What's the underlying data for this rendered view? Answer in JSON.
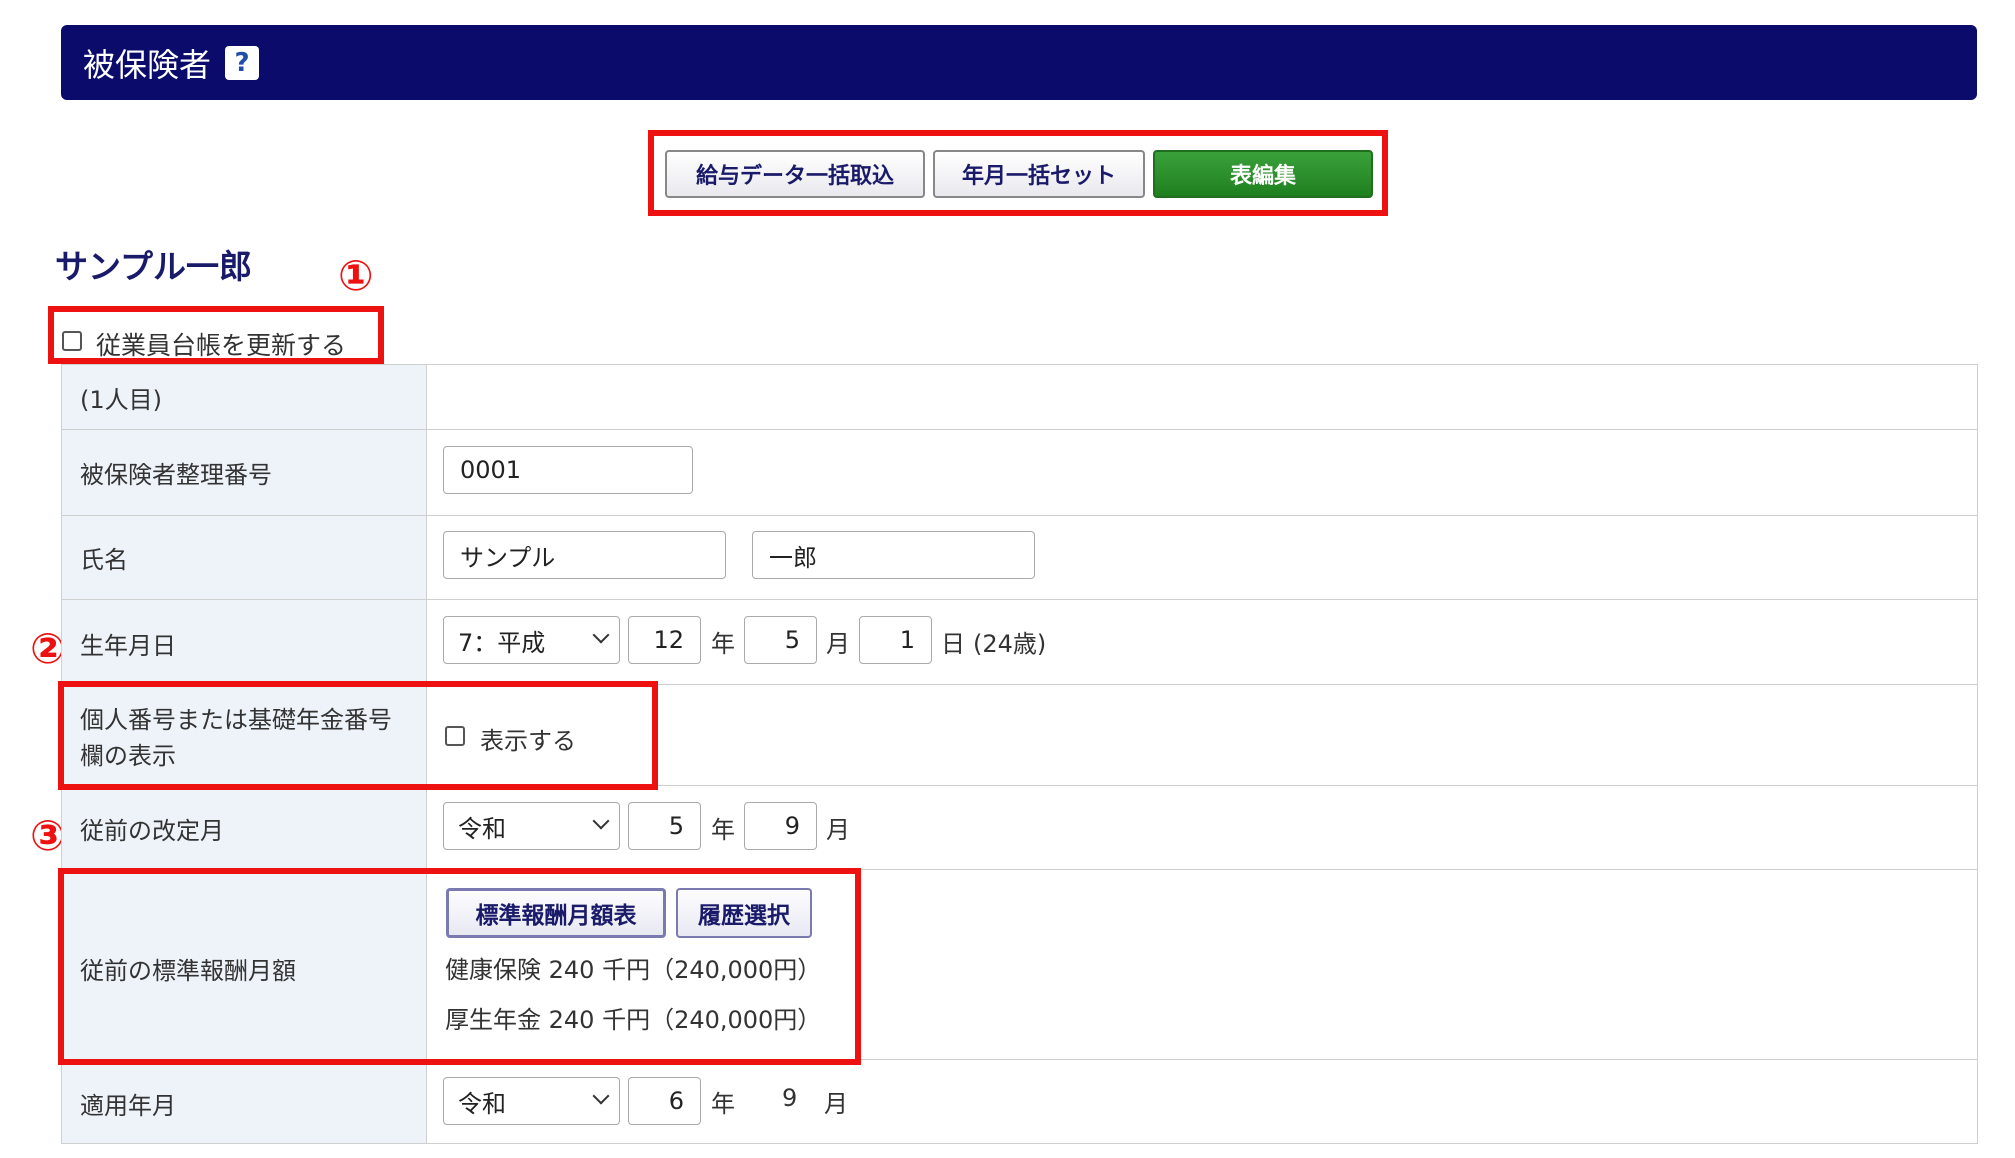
{
  "header": {
    "title": "被保険者",
    "help": "?"
  },
  "toolbar": {
    "bulk_import": "給与データ一括取込",
    "set_yearmonth": "年月一括セット",
    "table_edit": "表編集"
  },
  "employee": {
    "name": "サンプル一郎"
  },
  "markers": {
    "m1": "①",
    "m2": "②",
    "m3": "③"
  },
  "update_ledger": {
    "label": "従業員台帳を更新する",
    "checked": false
  },
  "form": {
    "person_index": "(1人目)",
    "insured_number": {
      "label": "被保険者整理番号",
      "value": "0001"
    },
    "name": {
      "label": "氏名",
      "last": "サンプル",
      "first": "一郎"
    },
    "birth": {
      "label": "生年月日",
      "era": "7：平成",
      "year": "12",
      "month": "5",
      "day": "1",
      "unit_year": "年",
      "unit_month": "月",
      "unit_day": "日",
      "age": "(24歳)"
    },
    "mynumber": {
      "label_line1": "個人番号または基礎年金番号",
      "label_line2": "欄の表示",
      "checkbox_label": "表示する",
      "checked": false
    },
    "prev_revision": {
      "label": "従前の改定月",
      "era": "令和",
      "year": "5",
      "month": "9",
      "unit_year": "年",
      "unit_month": "月"
    },
    "prev_standard": {
      "label": "従前の標準報酬月額",
      "btn_table": "標準報酬月額表",
      "btn_history": "履歴選択",
      "health": "健康保険 240 千円（240,000円）",
      "pension": "厚生年金 240 千円（240,000円）"
    },
    "applicable": {
      "label": "適用年月",
      "era": "令和",
      "year": "6",
      "month": "9",
      "unit_year": "年",
      "unit_month": "月"
    }
  },
  "colors": {
    "header_bg": "#0b0b6b",
    "highlight": "#ee1111",
    "button_green": "#2a8f2a",
    "label_bg": "#eef3fa"
  }
}
